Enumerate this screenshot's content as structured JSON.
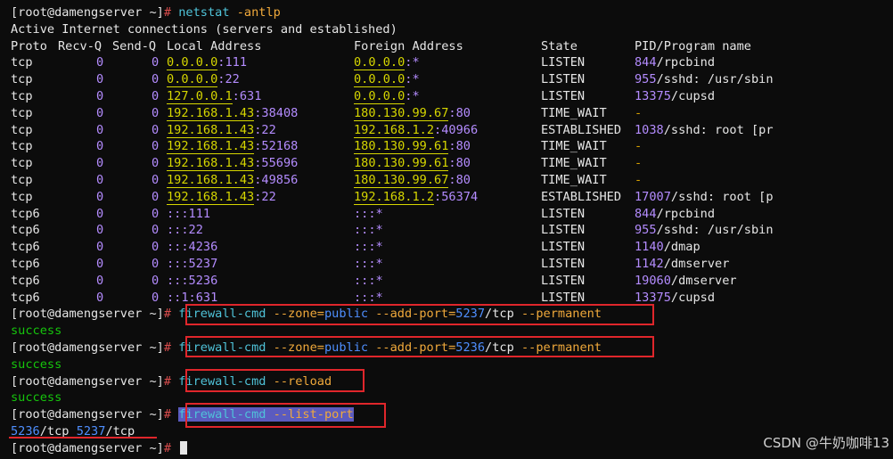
{
  "terminal": {
    "prompt": "[root@damengserver ~]",
    "cmd_netstat": "netstat",
    "cmd_netstat_args": "-antlp",
    "header_active": "Active Internet connections (servers and established)",
    "cols": {
      "proto": "Proto",
      "recvq": "Recv-Q",
      "sendq": "Send-Q",
      "local": "Local Address",
      "foreign": "Foreign Address",
      "state": "State",
      "pid": "PID/Program name"
    },
    "rows": [
      {
        "proto": "tcp",
        "recvq": "0",
        "sendq": "0",
        "local_ip": "0.0.0.0",
        "local_port": ":111",
        "foreign_ip": "0.0.0.0",
        "foreign_port": ":*",
        "state": "LISTEN",
        "pid": "844",
        "prog": "/rpcbind"
      },
      {
        "proto": "tcp",
        "recvq": "0",
        "sendq": "0",
        "local_ip": "0.0.0.0",
        "local_port": ":22",
        "foreign_ip": "0.0.0.0",
        "foreign_port": ":*",
        "state": "LISTEN",
        "pid": "955",
        "prog": "/sshd: /usr/sbin"
      },
      {
        "proto": "tcp",
        "recvq": "0",
        "sendq": "0",
        "local_ip": "127.0.0.1",
        "local_port": ":631",
        "foreign_ip": "0.0.0.0",
        "foreign_port": ":*",
        "state": "LISTEN",
        "pid": "13375",
        "prog": "/cupsd"
      },
      {
        "proto": "tcp",
        "recvq": "0",
        "sendq": "0",
        "local_ip": "192.168.1.43",
        "local_port": ":38408",
        "foreign_ip": "180.130.99.67",
        "foreign_port": ":80",
        "state": "TIME_WAIT",
        "pid": "-",
        "prog": ""
      },
      {
        "proto": "tcp",
        "recvq": "0",
        "sendq": "0",
        "local_ip": "192.168.1.43",
        "local_port": ":22",
        "foreign_ip": "192.168.1.2",
        "foreign_port": ":40966",
        "state": "ESTABLISHED",
        "pid": "1038",
        "prog": "/sshd: root [pr"
      },
      {
        "proto": "tcp",
        "recvq": "0",
        "sendq": "0",
        "local_ip": "192.168.1.43",
        "local_port": ":52168",
        "foreign_ip": "180.130.99.61",
        "foreign_port": ":80",
        "state": "TIME_WAIT",
        "pid": "-",
        "prog": ""
      },
      {
        "proto": "tcp",
        "recvq": "0",
        "sendq": "0",
        "local_ip": "192.168.1.43",
        "local_port": ":55696",
        "foreign_ip": "180.130.99.61",
        "foreign_port": ":80",
        "state": "TIME_WAIT",
        "pid": "-",
        "prog": ""
      },
      {
        "proto": "tcp",
        "recvq": "0",
        "sendq": "0",
        "local_ip": "192.168.1.43",
        "local_port": ":49856",
        "foreign_ip": "180.130.99.67",
        "foreign_port": ":80",
        "state": "TIME_WAIT",
        "pid": "-",
        "prog": ""
      },
      {
        "proto": "tcp",
        "recvq": "0",
        "sendq": "0",
        "local_ip": "192.168.1.43",
        "local_port": ":22",
        "foreign_ip": "192.168.1.2",
        "foreign_port": ":56374",
        "state": "ESTABLISHED",
        "pid": "17007",
        "prog": "/sshd: root [p"
      },
      {
        "proto": "tcp6",
        "recvq": "0",
        "sendq": "0",
        "local_ip": "",
        "local_port": ":::111",
        "foreign_ip": "",
        "foreign_port": ":::*",
        "state": "LISTEN",
        "pid": "844",
        "prog": "/rpcbind"
      },
      {
        "proto": "tcp6",
        "recvq": "0",
        "sendq": "0",
        "local_ip": "",
        "local_port": ":::22",
        "foreign_ip": "",
        "foreign_port": ":::*",
        "state": "LISTEN",
        "pid": "955",
        "prog": "/sshd: /usr/sbin"
      },
      {
        "proto": "tcp6",
        "recvq": "0",
        "sendq": "0",
        "local_ip": "",
        "local_port": ":::4236",
        "foreign_ip": "",
        "foreign_port": ":::*",
        "state": "LISTEN",
        "pid": "1140",
        "prog": "/dmap"
      },
      {
        "proto": "tcp6",
        "recvq": "0",
        "sendq": "0",
        "local_ip": "",
        "local_port": ":::5237",
        "foreign_ip": "",
        "foreign_port": ":::*",
        "state": "LISTEN",
        "pid": "1142",
        "prog": "/dmserver"
      },
      {
        "proto": "tcp6",
        "recvq": "0",
        "sendq": "0",
        "local_ip": "",
        "local_port": ":::5236",
        "foreign_ip": "",
        "foreign_port": ":::*",
        "state": "LISTEN",
        "pid": "19060",
        "prog": "/dmserver"
      },
      {
        "proto": "tcp6",
        "recvq": "0",
        "sendq": "0",
        "local_ip": "",
        "local_port": "::1:631",
        "foreign_ip": "",
        "foreign_port": ":::*",
        "state": "LISTEN",
        "pid": "13375",
        "prog": "/cupsd"
      }
    ],
    "fw": {
      "cmd": "firewall-cmd",
      "zone_opt": "--zone",
      "zone_val": "public",
      "addport_opt": "--add-port",
      "port1": "5237",
      "port2": "5236",
      "proto": "/tcp",
      "perm_opt": "--permanent",
      "reload_opt": "--reload",
      "listport_opt": "--list-port",
      "success": "success",
      "list_port1": "5236",
      "list_proto1": "/tcp",
      "list_port2": "5237",
      "list_proto2": "/tcp"
    }
  },
  "watermark": "CSDN @牛奶咖啡13",
  "colors": {
    "background": "#0c0c0c",
    "highlight_box": "#e0262b",
    "success": "#16c60c",
    "command": "#4fc3d9",
    "option": "#f0a93b"
  }
}
